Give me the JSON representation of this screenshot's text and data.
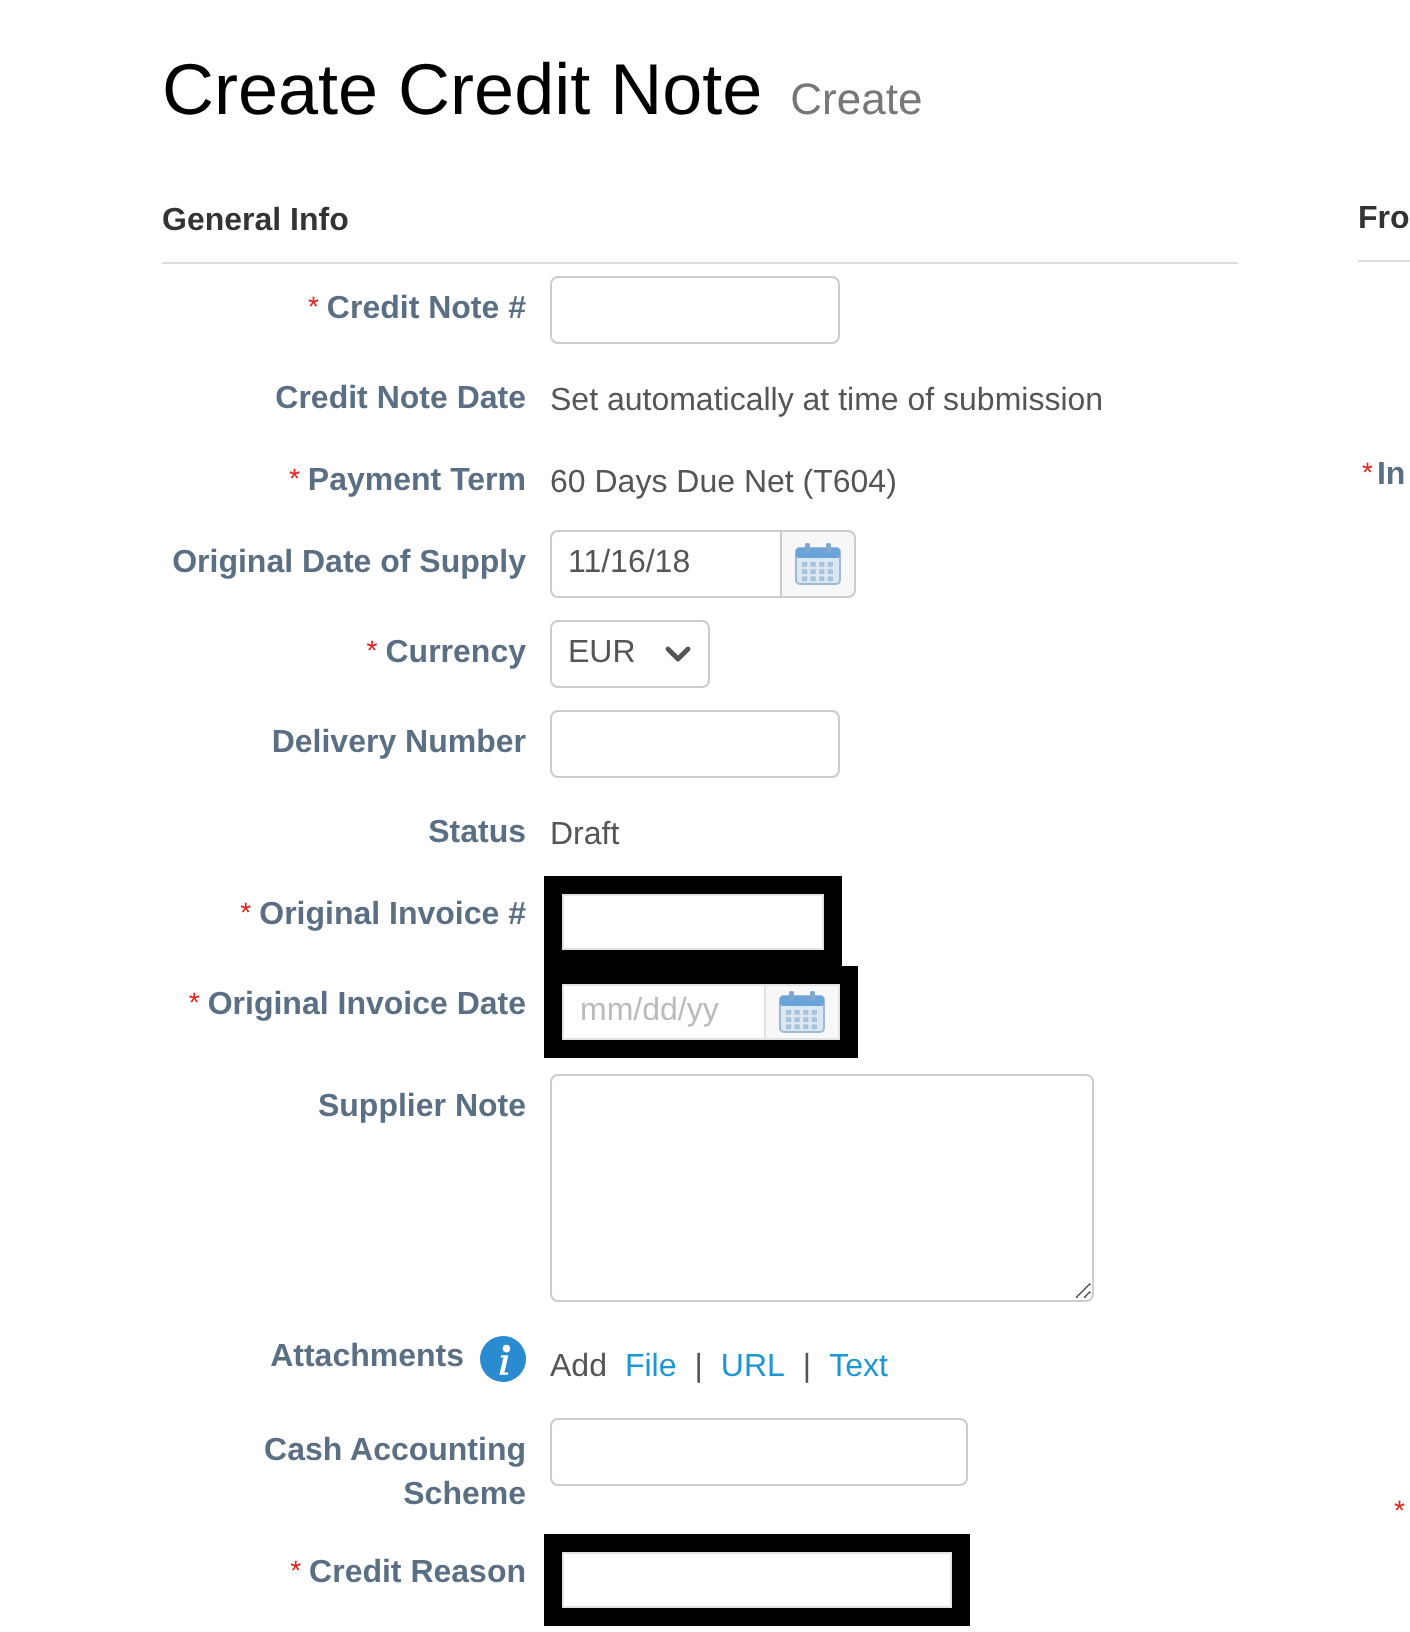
{
  "page": {
    "title": "Create Credit Note",
    "subtitle": "Create"
  },
  "general_info": {
    "heading": "General Info",
    "fields": [
      {
        "kind": "input",
        "required_mark": "*",
        "label": "Credit Note #",
        "redacted": false,
        "info": false
      },
      {
        "kind": "static",
        "label": "Credit Note Date",
        "value": "Set automatically at time of submission",
        "redacted": false,
        "info": false
      },
      {
        "kind": "static",
        "required_mark": "*",
        "label": "Payment Term",
        "value": "60 Days Due Net (T604)",
        "redacted": false,
        "info": false
      },
      {
        "kind": "date",
        "label": "Original Date of Supply",
        "value": "11/16/18",
        "redacted": false,
        "info": false
      },
      {
        "kind": "select",
        "required_mark": "*",
        "label": "Currency",
        "value": "EUR",
        "redacted": false,
        "info": false
      },
      {
        "kind": "input",
        "label": "Delivery Number",
        "redacted": false,
        "info": false
      },
      {
        "kind": "static",
        "label": "Status",
        "value": "Draft",
        "redacted": false,
        "info": false
      },
      {
        "kind": "input",
        "required_mark": "*",
        "label": "Original Invoice #",
        "redacted": true,
        "info": false
      },
      {
        "kind": "date",
        "required_mark": "*",
        "label": "Original Invoice Date",
        "placeholder": "mm/dd/yy",
        "redacted": true,
        "info": false
      },
      {
        "kind": "textarea",
        "label": "Supplier Note",
        "redacted": false,
        "info": false
      },
      {
        "kind": "attachments",
        "label": "Attachments",
        "redacted": false,
        "info": true,
        "items": [
          {
            "kind": "text",
            "text": "Add"
          },
          {
            "kind": "link",
            "text": "File"
          },
          {
            "kind": "separator",
            "text": "|"
          },
          {
            "kind": "link",
            "text": "URL"
          },
          {
            "kind": "separator",
            "text": "|"
          },
          {
            "kind": "link",
            "text": "Text"
          }
        ]
      },
      {
        "kind": "wide_input",
        "label": "Cash Accounting Scheme",
        "redacted": false,
        "info": false
      },
      {
        "kind": "wide_input",
        "required_mark": "*",
        "label": "Credit Reason",
        "redacted": true,
        "info": false
      }
    ]
  },
  "right_panel": {
    "heading": "Fro",
    "fields": [
      {
        "required_mark": "*",
        "label": "In"
      },
      {
        "required_mark": "*"
      }
    ]
  }
}
